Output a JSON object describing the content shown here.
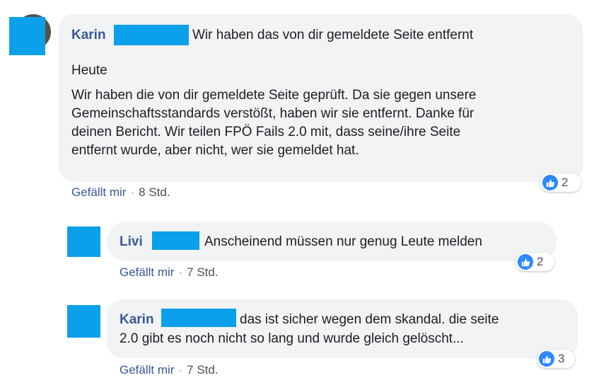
{
  "comments": [
    {
      "author": "Karin",
      "body_lines": [
        "Wir haben das von dir gemeldete Seite entfernt",
        "Heute",
        "Wir haben die von dir gemeldete Seite geprüft. Da sie gegen unsere",
        "Gemeinschaftsstandards verstößt, haben wir sie entfernt. Danke für",
        "deinen Bericht. Wir teilen FPÖ Fails 2.0 mit, dass seine/ihre Seite",
        "entfernt wurde, aber nicht, wer sie gemeldet hat."
      ],
      "like_label": "Gefällt mir",
      "separator": "·",
      "time": "8 Std.",
      "reaction_count": "2",
      "reaction_icon": "thumbs-up-icon"
    },
    {
      "author": "Livi",
      "body_lines": [
        "Anscheinend müssen nur genug Leute melden"
      ],
      "like_label": "Gefällt mir",
      "separator": "·",
      "time": "7 Std.",
      "reaction_count": "2",
      "reaction_icon": "thumbs-up-icon"
    },
    {
      "author": "Karin",
      "body_lines": [
        "das ist sicher wegen dem skandal. die seite",
        "2.0 gibt es noch nicht so lang und wurde gleich gelöscht..."
      ],
      "like_label": "Gefällt mir",
      "separator": "·",
      "time": "7 Std.",
      "reaction_count": "3",
      "reaction_icon": "thumbs-up-icon"
    }
  ],
  "colors": {
    "author": "#385898",
    "redaction": "#0aa0ea",
    "bubble": "#f2f3f5",
    "like_blue": "#2d88ff"
  }
}
